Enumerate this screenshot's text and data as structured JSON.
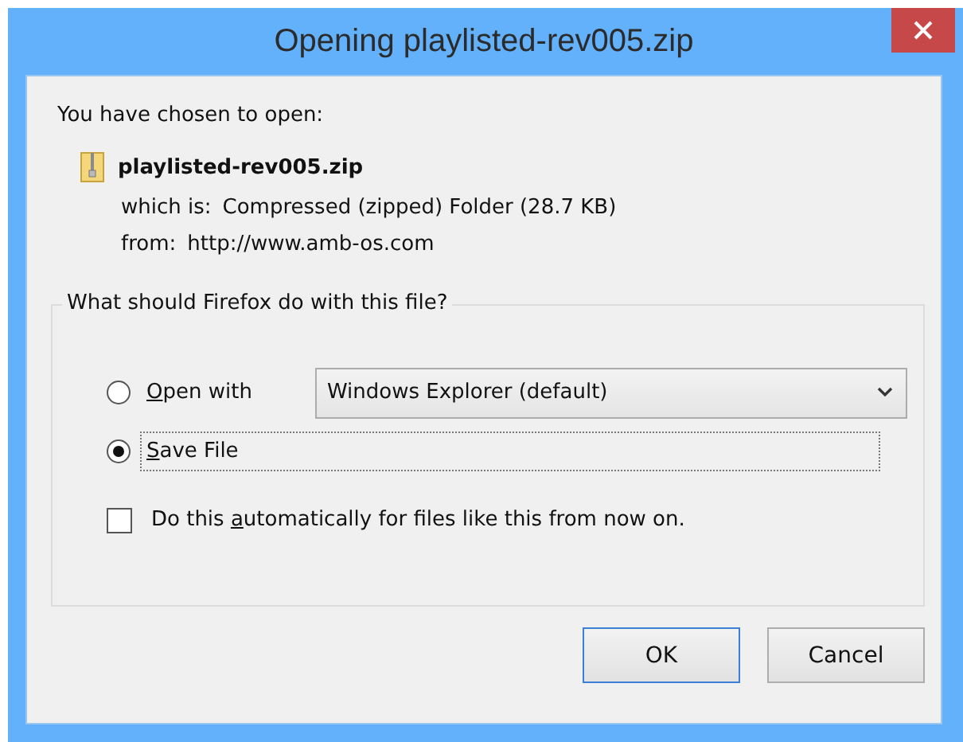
{
  "window": {
    "title": "Opening playlisted-rev005.zip"
  },
  "intro": "You have chosen to open:",
  "file": {
    "name": "playlisted-rev005.zip",
    "details": [
      {
        "label": "which is:",
        "value": "Compressed (zipped) Folder (28.7 KB)"
      },
      {
        "label": "from:",
        "value": "http://www.amb-os.com"
      }
    ]
  },
  "action_group": {
    "legend": "What should Firefox do with this file?",
    "options": [
      {
        "mnemonic": "O",
        "after": "pen with",
        "selected": false,
        "dropdown": "Windows Explorer (default)",
        "focused": false
      },
      {
        "mnemonic": "S",
        "after": "ave File",
        "selected": true,
        "focused": true
      }
    ],
    "remember": {
      "before": "Do this ",
      "mnemonic": "a",
      "after": "utomatically for files like this from now on.",
      "checked": false
    }
  },
  "buttons": [
    {
      "label": "OK",
      "default": true
    },
    {
      "label": "Cancel",
      "default": false
    }
  ]
}
